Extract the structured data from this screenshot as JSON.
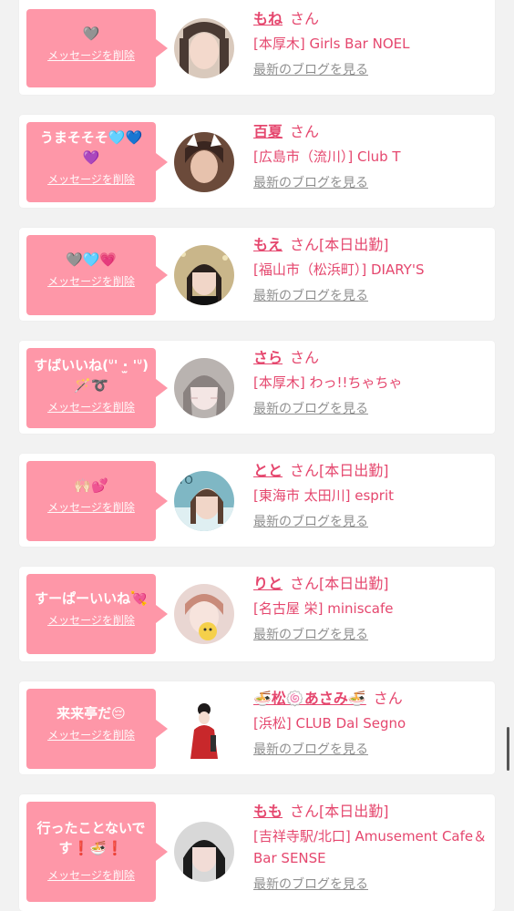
{
  "delete_label": "メッセージを削除",
  "blog_label": "最新のブログを見る",
  "colors": {
    "bubble": "#fe97a8",
    "accent": "#e5476e",
    "muted": "#8f8f8f",
    "background": "#f2f2f2"
  },
  "entries": [
    {
      "message": "🩶",
      "name": "もね",
      "san": "さん",
      "status": "",
      "shop": "[本厚木] Girls Bar NOEL"
    },
    {
      "message": "うまそそそ🩵💙💜",
      "name": "百夏",
      "san": "さん",
      "status": "",
      "shop": "[広島市（流川）] Club T"
    },
    {
      "message": "🩶🩵💗",
      "name": "もえ",
      "san": "さん",
      "status": "[本日出勤]",
      "shop": "[福山市（松浜町）] DIARY'S"
    },
    {
      "message": "すばいいね(ᐡ' ·̫ 'ᐡ)🪄➰",
      "name": "さら",
      "san": "さん",
      "status": "",
      "shop": "[本厚木] わっ!!ちゃちゃ"
    },
    {
      "message": "🙌🏻💕",
      "name": "とと",
      "san": "さん",
      "status": "[本日出勤]",
      "shop": "[東海市 太田川] esprit"
    },
    {
      "message": "すーぱーいいね💘",
      "name": "りと",
      "san": "さん",
      "status": "[本日出勤]",
      "shop": "[名古屋 栄] miniscafe"
    },
    {
      "message": "来来亭だ😔",
      "name": "🍜松🍥あさみ🍜",
      "san": "さん",
      "status": "",
      "shop": "[浜松] CLUB Dal Segno"
    },
    {
      "message": "行ったことないです❗️🍜❗️",
      "name": "もも",
      "san": "さん",
      "status": "[本日出勤]",
      "shop": "[吉祥寺駅/北口] Amusement Cafe＆Bar SENSE"
    }
  ]
}
